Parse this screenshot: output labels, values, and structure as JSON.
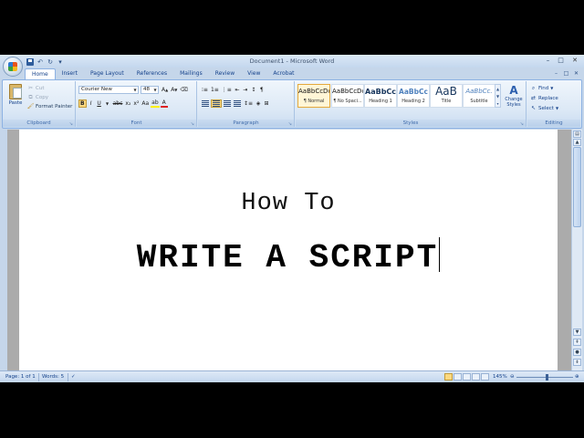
{
  "window": {
    "title": "Document1 - Microsoft Word"
  },
  "tabs": [
    "Home",
    "Insert",
    "Page Layout",
    "References",
    "Mailings",
    "Review",
    "View",
    "Acrobat"
  ],
  "clipboard": {
    "paste": "Paste",
    "cut": "Cut",
    "copy": "Copy",
    "format_painter": "Format Painter",
    "label": "Clipboard"
  },
  "font": {
    "name": "Courier New",
    "size": "48",
    "label": "Font"
  },
  "paragraph": {
    "label": "Paragraph"
  },
  "styles": {
    "label": "Styles",
    "tiles": [
      {
        "preview": "AaBbCcDc",
        "name": "¶ Normal"
      },
      {
        "preview": "AaBbCcDc",
        "name": "¶ No Spaci..."
      },
      {
        "preview": "AaBbCc",
        "name": "Heading 1"
      },
      {
        "preview": "AaBbCc",
        "name": "Heading 2"
      },
      {
        "preview": "AaB",
        "name": "Title"
      },
      {
        "preview": "AaBbCc.",
        "name": "Subtitle"
      }
    ],
    "change_styles": "Change Styles"
  },
  "editing": {
    "find": "Find",
    "replace": "Replace",
    "select": "Select",
    "label": "Editing"
  },
  "document": {
    "line1": "How To",
    "line2": "WRITE A SCRIPT"
  },
  "status": {
    "page": "Page: 1 of 1",
    "words": "Words: 5",
    "zoom": "145%"
  },
  "colors": {
    "ribbon": "#dde9f6",
    "accent": "#15428b",
    "selected": "#fcd980"
  }
}
